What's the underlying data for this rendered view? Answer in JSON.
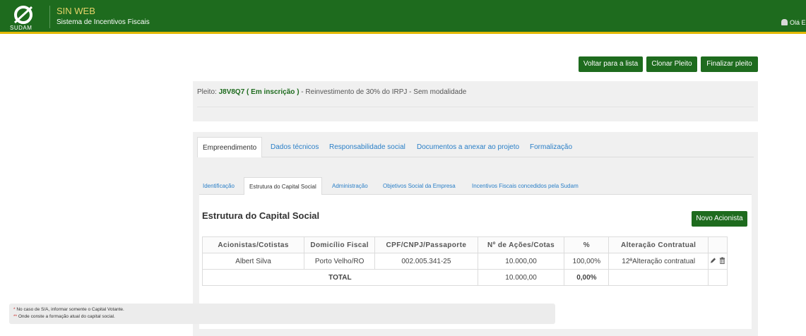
{
  "header": {
    "logo_text": "SUDAM",
    "app_name": "SIN WEB",
    "app_subtitle": "Sistema de Incentivos Fiscais",
    "user_greeting": "Olá E"
  },
  "actions": {
    "back_label": "Voltar para a lista",
    "clone_label": "Clonar Pleito",
    "finish_label": "Finalizar pleito"
  },
  "pleito": {
    "prefix": "Pleito: ",
    "code": "J8V8Q7 ( Em inscrição )",
    "description": " - Reinvestimento de 30% do IRPJ - Sem modalidade"
  },
  "main_tabs": [
    {
      "label": "Empreendimento",
      "active": true
    },
    {
      "label": "Dados técnicos"
    },
    {
      "label": "Responsabilidade social"
    },
    {
      "label": "Documentos a anexar ao projeto"
    },
    {
      "label": "Formalização"
    }
  ],
  "sub_tabs": [
    {
      "label": "Identificação"
    },
    {
      "label": "Estrutura do Capital Social",
      "active": true
    },
    {
      "label": "Administração"
    },
    {
      "label": "Objetivos Social da Empresa"
    },
    {
      "label": "Incentivos Fiscais concedidos pela Sudam"
    }
  ],
  "section": {
    "title": "Estrutura do Capital Social",
    "new_button": "Novo Acionista"
  },
  "table": {
    "columns": [
      "Acionistas/Cotistas",
      "Domicílio Fiscal",
      "CPF/CNPJ/Passaporte",
      "Nº de Ações/Cotas",
      "%",
      "Alteração Contratual",
      ""
    ],
    "rows": [
      {
        "name": "Albert Silva",
        "domicile": "Porto Velho/RO",
        "document": "002.005.341-25",
        "shares": "10.000,00",
        "percent": "100,00%",
        "amendment": "12ªAlteração contratual"
      }
    ],
    "total": {
      "label": "TOTAL",
      "shares": "10.000,00",
      "percent": "0,00%"
    }
  },
  "notes": {
    "note1_star": "*",
    "note1": " No caso de S/A, informar somente o Capital Votante.",
    "note2_star": "**",
    "note2": " Onde conste a formação atual do capital social."
  },
  "colors": {
    "brand_green": "#1e6b1e",
    "accent_yellow": "#e3b800",
    "link_blue": "#2a7fc7"
  }
}
